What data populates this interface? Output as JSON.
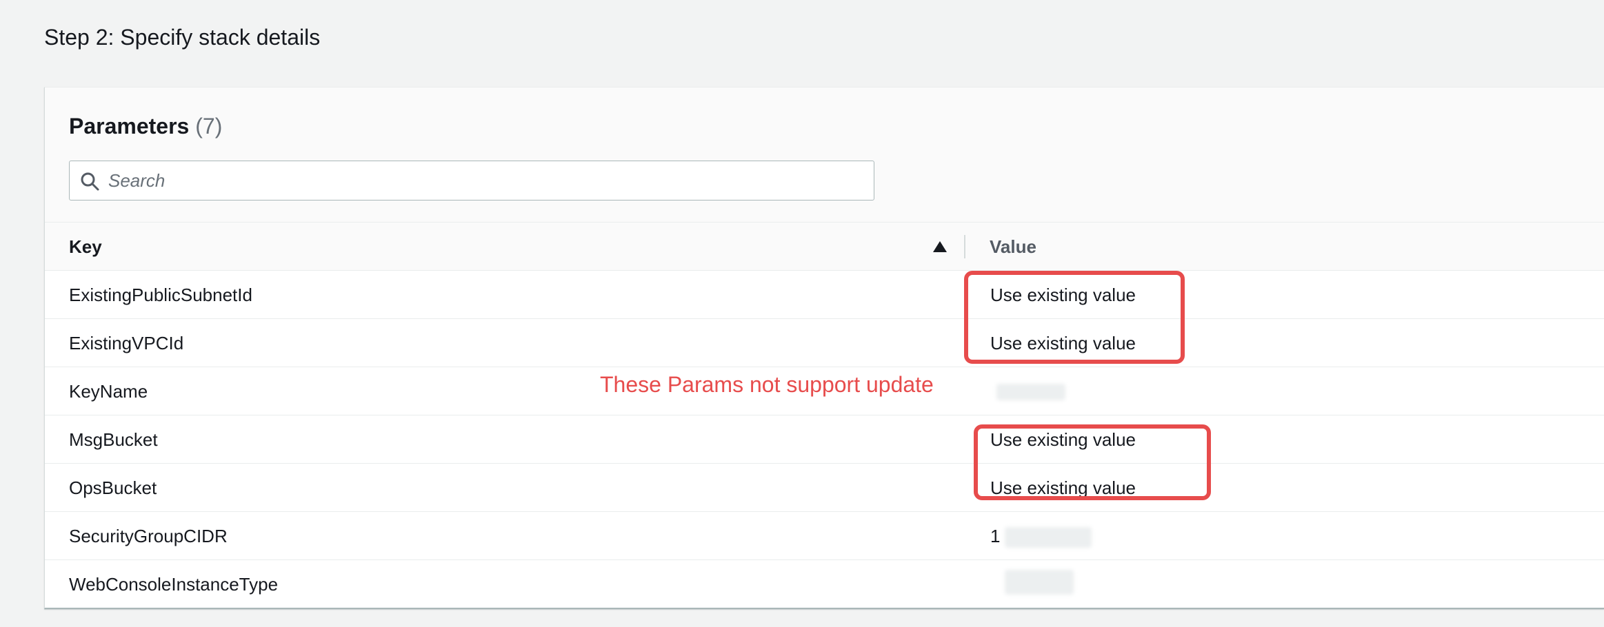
{
  "page": {
    "title": "Step 2: Specify stack details"
  },
  "parameters": {
    "title": "Parameters",
    "count": "(7)",
    "search_placeholder": "Search",
    "columns": {
      "key": "Key",
      "value": "Value"
    },
    "rows": [
      {
        "key": "ExistingPublicSubnetId",
        "value": "Use existing value"
      },
      {
        "key": "ExistingVPCId",
        "value": "Use existing value"
      },
      {
        "key": "KeyName",
        "value": ""
      },
      {
        "key": "MsgBucket",
        "value": "Use existing value"
      },
      {
        "key": "OpsBucket",
        "value": "Use existing value"
      },
      {
        "key": "SecurityGroupCIDR",
        "value": "1"
      },
      {
        "key": "WebConsoleInstanceType",
        "value": ""
      }
    ]
  },
  "annotation": {
    "text": "These Params not support update",
    "color": "#e74c4c"
  },
  "icons": {
    "search": "search-icon",
    "sort": "sort-ascending-icon"
  }
}
